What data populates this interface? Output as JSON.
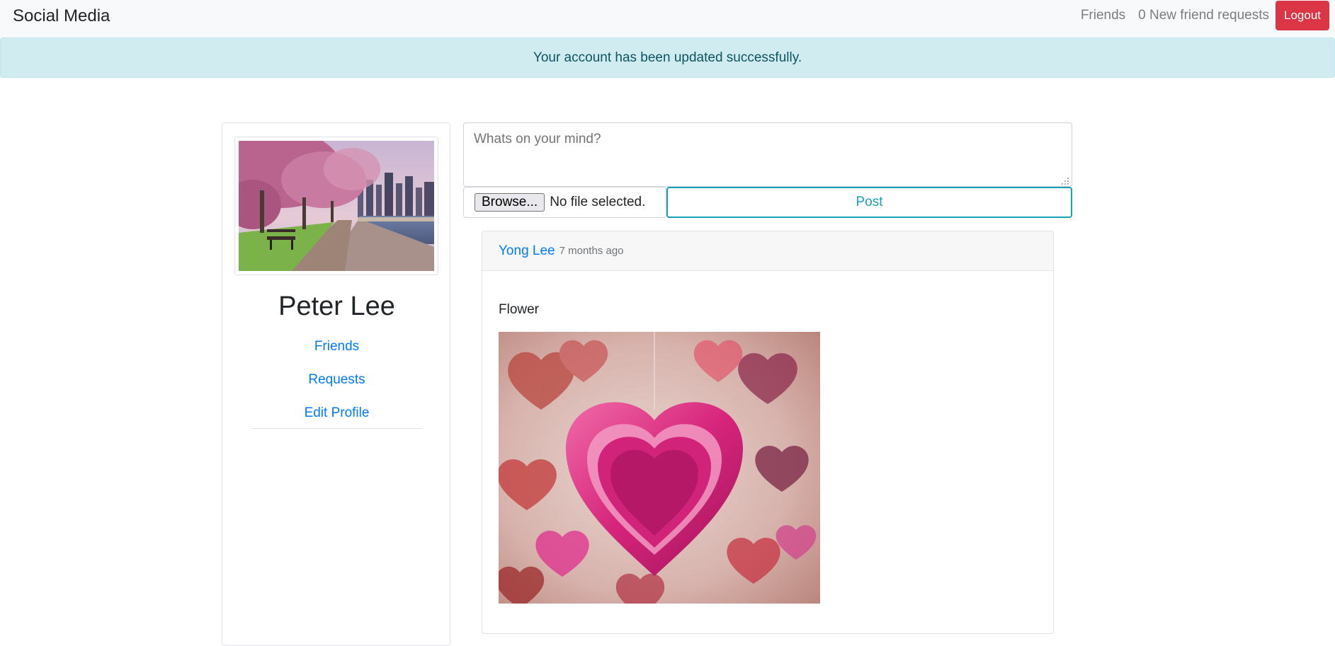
{
  "navbar": {
    "brand": "Social Media",
    "friends_link": "Friends",
    "requests_link": "0 New friend requests",
    "logout_label": "Logout",
    "logout_color": "#dc3545"
  },
  "alert": {
    "message": "Your account has been updated successfully."
  },
  "profile": {
    "name": "Peter Lee",
    "links": {
      "friends": "Friends",
      "requests": "Requests",
      "edit_profile": "Edit Profile"
    }
  },
  "composer": {
    "placeholder": "Whats on your mind?",
    "browse_label": "Browse...",
    "file_status": "No file selected.",
    "post_label": "Post"
  },
  "post": {
    "author": "Yong Lee",
    "time": "7 months ago",
    "text": "Flower"
  },
  "colors": {
    "link": "#007bff",
    "alert_bg": "#d1ecf1",
    "post_button": "#17a2b8"
  }
}
